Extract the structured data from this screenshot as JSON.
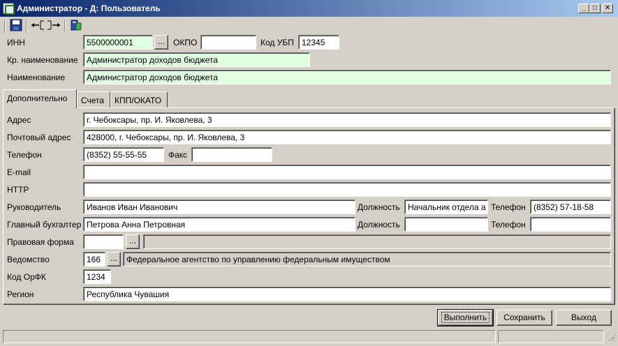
{
  "window": {
    "title": "Администратор - Д: Пользователь",
    "minimize": "_",
    "maximize": "□",
    "close": "✕"
  },
  "toolbar": {
    "save_icon": "floppy-disk-icon",
    "collapse_icon": "arrows-in-icon",
    "expand_icon": "arrows-out-icon",
    "db_icon": "database-icon"
  },
  "header": {
    "inn_label": "ИНН",
    "inn_value": "5500000001",
    "okpo_label": "ОКПО",
    "okpo_value": "",
    "kod_ubp_label": "Код УБП",
    "kod_ubp_value": "12345",
    "short_name_label": "Кр. наименование",
    "short_name_value": "Администратор доходов бюджета",
    "name_label": "Наименование",
    "name_value": "Администратор доходов бюджета",
    "dots": "..."
  },
  "tabs": [
    {
      "label": "Дополнительно",
      "active": true
    },
    {
      "label": "Счета",
      "active": false
    },
    {
      "label": "КПП/ОКАТО",
      "active": false
    }
  ],
  "form": {
    "address_label": "Адрес",
    "address_value": "г. Чебоксары, пр. И. Яковлева, 3",
    "postal_label": "Почтовый адрес",
    "postal_value": "428000, г. Чебоксары, пр. И. Яковлева, 3",
    "phone_label": "Телефон",
    "phone_value": "(8352) 55-55-55",
    "fax_label": "Факс",
    "fax_value": "",
    "email_label": "E-mail",
    "email_value": "",
    "http_label": "HTTP",
    "http_value": "",
    "head_label": "Руководитель",
    "head_value": "Иванов Иван Иванович",
    "head_position_label": "Должность",
    "head_position_value": "Начальник отдела а",
    "head_phone_label": "Телефон",
    "head_phone_value": "(8352) 57-18-58",
    "accountant_label": "Главный бухгалтер",
    "accountant_value": "Петрова Анна Петровная",
    "accountant_position_label": "Должность",
    "accountant_position_value": "",
    "accountant_phone_label": "Телефон",
    "accountant_phone_value": "",
    "legal_form_label": "Правовая форма",
    "legal_form_value": "",
    "legal_form_desc": "",
    "agency_label": "Ведомство",
    "agency_code": "166",
    "agency_desc": "Федеральное агентство по управлению федеральным имуществом",
    "orfk_label": "Код ОрФК",
    "orfk_value": "1234",
    "region_label": "Регион",
    "region_value": "Республика Чувашия",
    "dots": "..."
  },
  "buttons": {
    "execute": "Выполнить",
    "save": "Сохранить",
    "exit": "Выход"
  }
}
